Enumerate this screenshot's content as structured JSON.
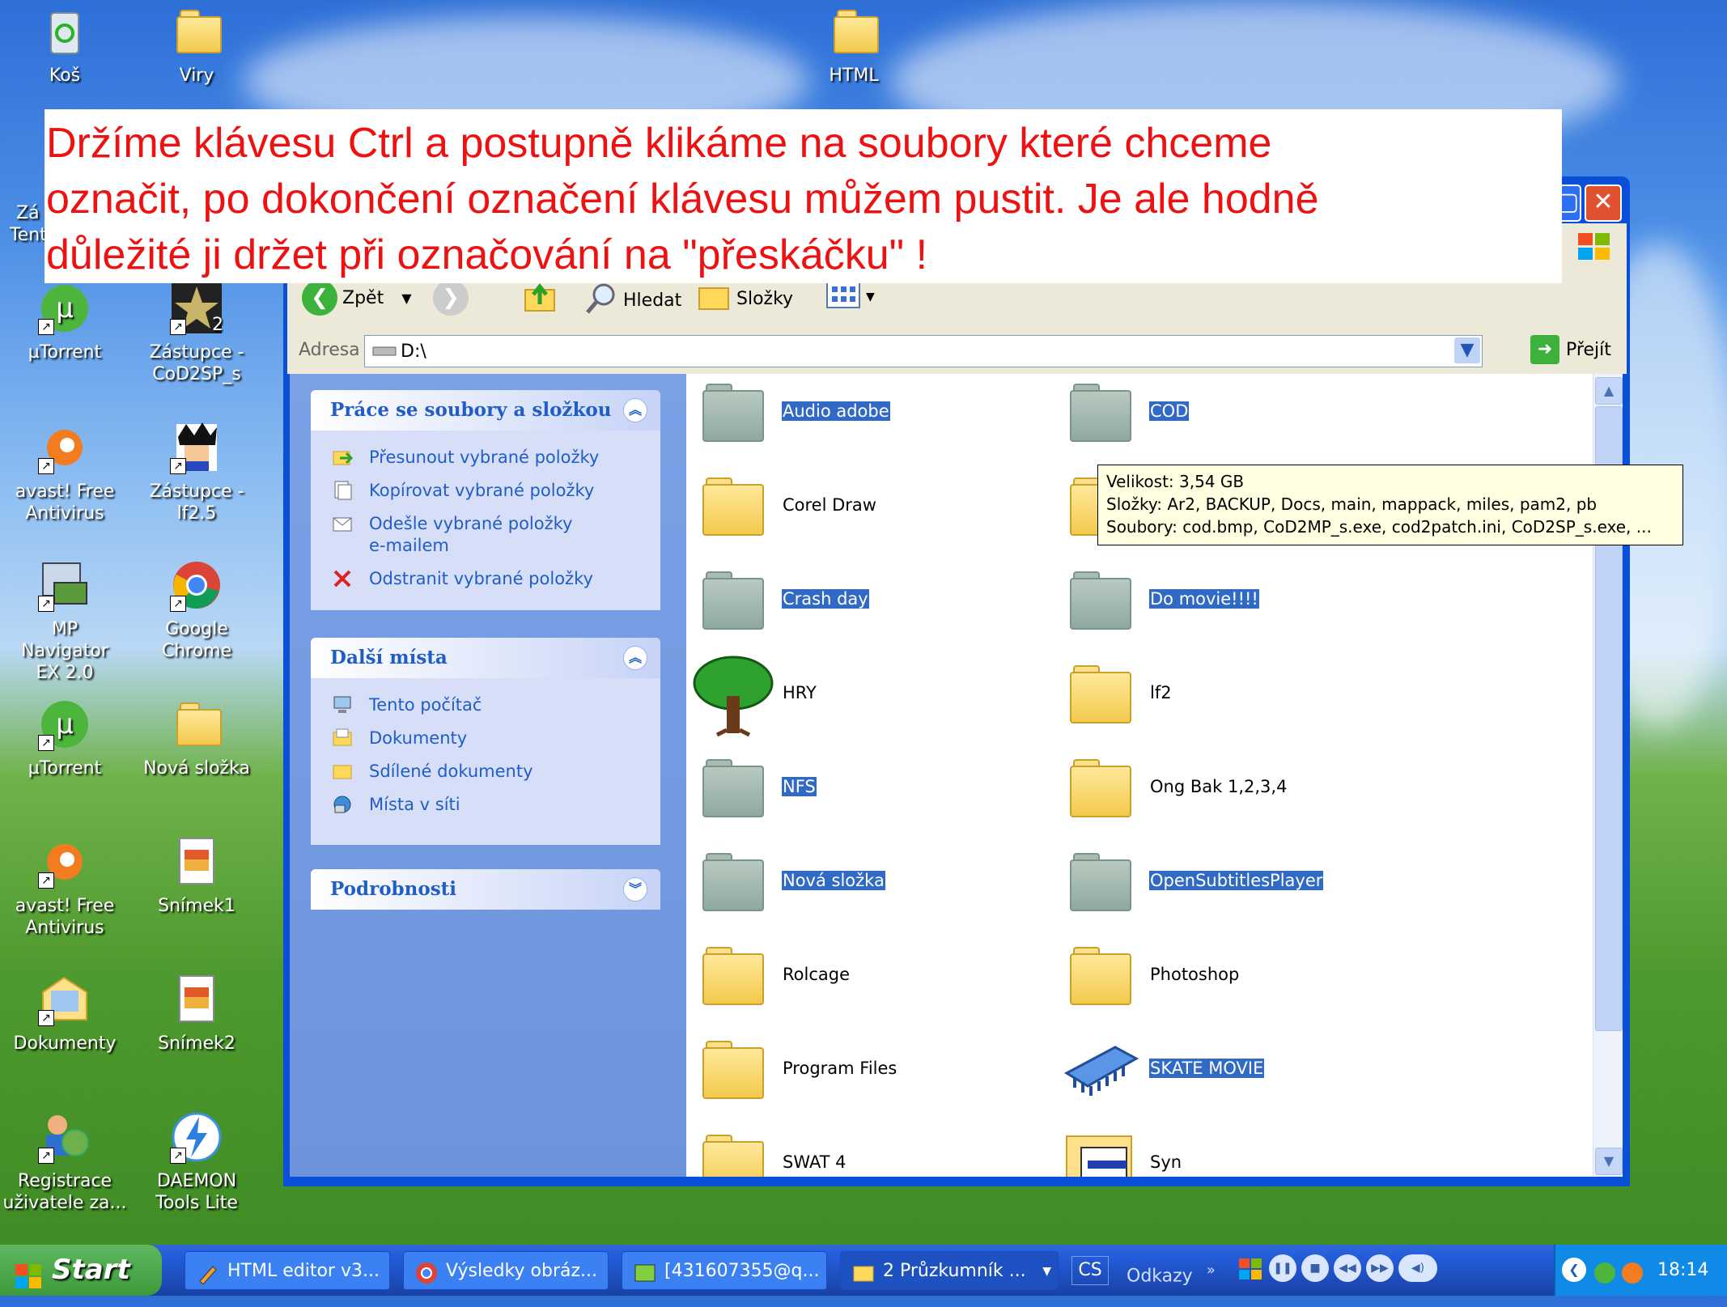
{
  "banner": {
    "line1": "Držíme klávesu Ctrl a postupně klikáme na soubory které chceme",
    "line2": "označit, po dokončení označení klávesu můžem pustit. Je ale hodně",
    "line3": "důležité ji držet při označování na \"přeskáčku\" !"
  },
  "desktop": {
    "top_icons": [
      {
        "label": "Koš"
      },
      {
        "label": "Viry"
      },
      {
        "label": "HTML"
      }
    ],
    "partial_label": {
      "line1": "Zá",
      "line2": "Tent"
    },
    "left_icons": [
      {
        "label": "µTorrent"
      },
      {
        "label": "Zástupce - CoD2SP_s"
      },
      {
        "label": "avast! Free Antivirus"
      },
      {
        "label": "Zástupce - lf2.5"
      },
      {
        "label": "MP Navigator EX 2.0"
      },
      {
        "label": "Google Chrome"
      },
      {
        "label": "µTorrent"
      },
      {
        "label": "Nová složka"
      },
      {
        "label": "avast! Free Antivirus"
      },
      {
        "label": "Snímek1"
      },
      {
        "label": "Dokumenty"
      },
      {
        "label": "Snímek2"
      },
      {
        "label": "Registrace uživatele za..."
      },
      {
        "label": "DAEMON Tools Lite"
      }
    ]
  },
  "window": {
    "toolbar": {
      "back_label": "Zpět",
      "search_label": "Hledat",
      "folders_label": "Složky"
    },
    "address": {
      "label": "Adresa",
      "value": "D:\\",
      "go_label": "Přejít"
    },
    "tasks_panel": {
      "title": "Práce se soubory a složkou",
      "items": [
        {
          "label": "Přesunout vybrané položky"
        },
        {
          "label": "Kopírovat vybrané položky"
        },
        {
          "label": "Odešle vybrané položky e-mailem"
        },
        {
          "label": "Odstranit vybrané položky"
        }
      ]
    },
    "places_panel": {
      "title": "Další místa",
      "items": [
        {
          "label": "Tento počítač"
        },
        {
          "label": "Dokumenty"
        },
        {
          "label": "Sdílené dokumenty"
        },
        {
          "label": "Místa v síti"
        }
      ]
    },
    "details_panel": {
      "title": "Podrobnosti"
    },
    "files": [
      {
        "name": "Audio adobe",
        "selected": true
      },
      {
        "name": "COD",
        "selected": true
      },
      {
        "name": "Corel Draw",
        "selected": false
      },
      {
        "name": "",
        "selected": false
      },
      {
        "name": "Crash day",
        "selected": true
      },
      {
        "name": "Do movie!!!!",
        "selected": true
      },
      {
        "name": "HRY",
        "selected": false
      },
      {
        "name": "lf2",
        "selected": false
      },
      {
        "name": "NFS",
        "selected": true
      },
      {
        "name": "Ong Bak 1,2,3,4",
        "selected": false
      },
      {
        "name": "Nová složka",
        "selected": true
      },
      {
        "name": "OpenSubtitlesPlayer",
        "selected": true
      },
      {
        "name": "Rolcage",
        "selected": false
      },
      {
        "name": "Photoshop",
        "selected": false
      },
      {
        "name": "Program Files",
        "selected": false
      },
      {
        "name": "SKATE MOVIE",
        "selected": true
      },
      {
        "name": "SWAT 4",
        "selected": false
      },
      {
        "name": "Syn",
        "selected": false
      }
    ],
    "tooltip": {
      "line1": "Velikost: 3,54 GB",
      "line2": "Složky: Ar2, BACKUP, Docs, main, mappack, miles, pam2, pb",
      "line3": "Soubory: cod.bmp, CoD2MP_s.exe, cod2patch.ini, CoD2SP_s.exe, ..."
    }
  },
  "taskbar": {
    "start_label": "Start",
    "buttons": [
      {
        "label": "HTML editor v3..."
      },
      {
        "label": "Výsledky obráz..."
      },
      {
        "label": "[431607355@q..."
      },
      {
        "label": "2 Průzkumník ..."
      }
    ],
    "lang": "CS",
    "links_label": "Odkazy",
    "clock": "18:14"
  },
  "colors": {
    "banner_text": "#ee1111",
    "selection": "#316ac5",
    "xp_blue": "#0a4fd8",
    "task_link": "#215dc6"
  }
}
